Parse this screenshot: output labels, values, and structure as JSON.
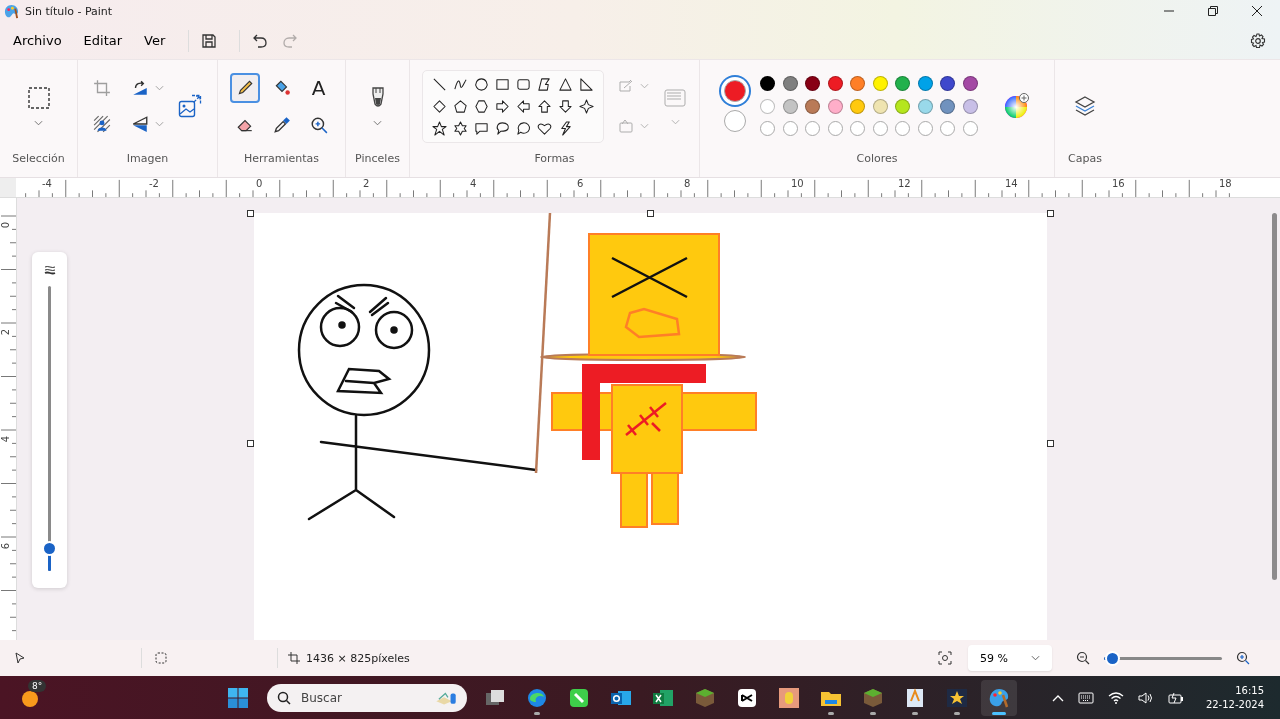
{
  "window": {
    "title": "Sin título - Paint"
  },
  "menu": [
    {
      "label": "Archivo"
    },
    {
      "label": "Editar"
    },
    {
      "label": "Ver"
    }
  ],
  "quick_actions": [
    {
      "kind": "save",
      "disabled": false
    },
    {
      "kind": "undo",
      "disabled": false
    },
    {
      "kind": "redo",
      "disabled": true
    }
  ],
  "selection_group": {
    "label": "Selección"
  },
  "image_group": {
    "label": "Imagen"
  },
  "tools_group": {
    "label": "Herramientas",
    "tools": [
      {
        "kind": "pencil",
        "selected": true
      },
      {
        "kind": "fill",
        "selected": false
      },
      {
        "kind": "text",
        "label": "A",
        "selected": false
      },
      {
        "kind": "eraser",
        "selected": false
      },
      {
        "kind": "picker",
        "selected": false
      },
      {
        "kind": "magnifier",
        "selected": false
      }
    ]
  },
  "brushes_group": {
    "label": "Pinceles"
  },
  "shapes_group": {
    "label": "Formas"
  },
  "colors_group": {
    "label": "Colores",
    "primary": {
      "color": "#ed1c24",
      "selected": true
    },
    "secondary": {
      "color": "#ffffff",
      "selected": false
    },
    "swatches": [
      {
        "kind": "color",
        "color": "#000000"
      },
      {
        "kind": "color",
        "color": "#7f7f7f"
      },
      {
        "kind": "color",
        "color": "#880015"
      },
      {
        "kind": "color",
        "color": "#ed1c24"
      },
      {
        "kind": "color",
        "color": "#ff7f27"
      },
      {
        "kind": "color",
        "color": "#fff200"
      },
      {
        "kind": "color",
        "color": "#22b14c"
      },
      {
        "kind": "color",
        "color": "#00a2e8"
      },
      {
        "kind": "color",
        "color": "#3f48cc"
      },
      {
        "kind": "color",
        "color": "#a349a4"
      },
      {
        "kind": "color",
        "color": "#ffffff"
      },
      {
        "kind": "color",
        "color": "#c3c3c3"
      },
      {
        "kind": "color",
        "color": "#b97a57"
      },
      {
        "kind": "color",
        "color": "#ffaec9"
      },
      {
        "kind": "color",
        "color": "#ffc90e"
      },
      {
        "kind": "color",
        "color": "#efe4b0"
      },
      {
        "kind": "color",
        "color": "#b5e61d"
      },
      {
        "kind": "color",
        "color": "#99d9ea"
      },
      {
        "kind": "color",
        "color": "#7092be"
      },
      {
        "kind": "color",
        "color": "#c8bfe7"
      },
      {
        "kind": "empty"
      },
      {
        "kind": "empty"
      },
      {
        "kind": "empty"
      },
      {
        "kind": "empty"
      },
      {
        "kind": "empty"
      },
      {
        "kind": "empty"
      },
      {
        "kind": "empty"
      },
      {
        "kind": "empty"
      },
      {
        "kind": "empty"
      },
      {
        "kind": "empty"
      }
    ]
  },
  "layers_group": {
    "label": "Capas"
  },
  "ruler": {
    "horizontal": [
      "-4",
      "-2",
      "0",
      "2",
      "4",
      "6",
      "8",
      "10",
      "12",
      "14",
      "16",
      "18"
    ],
    "vertical": [
      "0",
      "2",
      "4",
      "6"
    ]
  },
  "size_slider": {
    "level": 0.08
  },
  "status_bar": {
    "dimensions": "1436 × 825píxeles",
    "zoom": "59 %",
    "zoom_slider": {
      "level": 0.08
    }
  },
  "taskbar": {
    "weather": "8°",
    "search": {
      "placeholder": "Buscar"
    },
    "apps": [
      {
        "kind": "task-view",
        "running": false,
        "selected": false
      },
      {
        "kind": "swirl",
        "running": true,
        "selected": false
      },
      {
        "kind": "green-app",
        "running": false,
        "selected": false
      },
      {
        "kind": "mail",
        "running": false,
        "selected": false
      },
      {
        "kind": "sheet",
        "running": false,
        "selected": false
      },
      {
        "kind": "grass",
        "running": false,
        "selected": false
      },
      {
        "kind": "cut",
        "running": false,
        "selected": false
      },
      {
        "kind": "game",
        "running": false,
        "selected": false
      },
      {
        "kind": "folder",
        "running": true,
        "selected": false
      },
      {
        "kind": "grass",
        "running": true,
        "selected": false
      },
      {
        "kind": "document",
        "running": true,
        "selected": false
      },
      {
        "kind": "star",
        "running": true,
        "selected": false
      },
      {
        "kind": "palette",
        "running": true,
        "selected": true
      }
    ],
    "time": "16:15",
    "date": "22-12-2024"
  }
}
